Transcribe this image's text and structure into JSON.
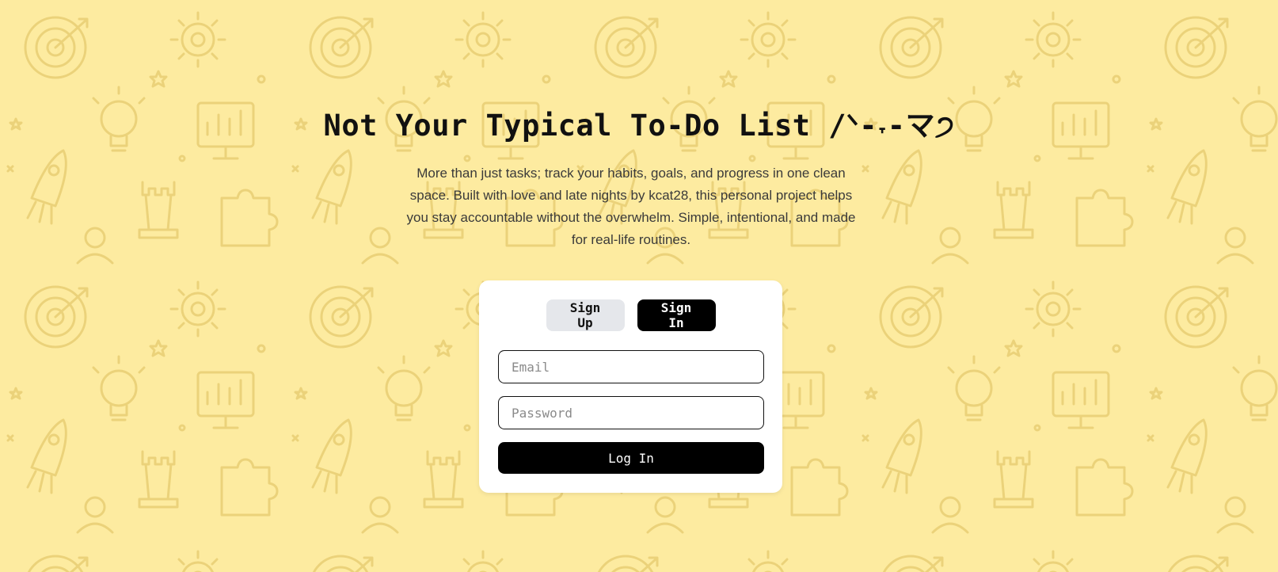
{
  "theme": {
    "background": "#FDEBA0",
    "pattern_stroke": "#EBD27A",
    "accent": "#000000",
    "card": "#FFFFFF"
  },
  "hero": {
    "title": "Not Your Typical To-Do List /ᐠ-˕-マ੭",
    "tagline": "More than just tasks; track your habits, goals, and progress in one clean space. Built with love and late nights by kcat28, this personal project helps you stay accountable without the overwhelm. Simple, intentional, and made for real-life routines."
  },
  "auth": {
    "tabs": {
      "signup_label": "Sign Up",
      "signin_label": "Sign In",
      "active": "signin"
    },
    "email": {
      "placeholder": "Email",
      "value": ""
    },
    "password": {
      "placeholder": "Password",
      "value": ""
    },
    "submit_label": "Log In"
  },
  "background_icons": [
    "rocket-icon",
    "target-icon",
    "gear-icon",
    "lightbulb-icon",
    "chart-board-icon",
    "chess-rook-icon",
    "puzzle-icon",
    "star-icon",
    "person-icon"
  ]
}
